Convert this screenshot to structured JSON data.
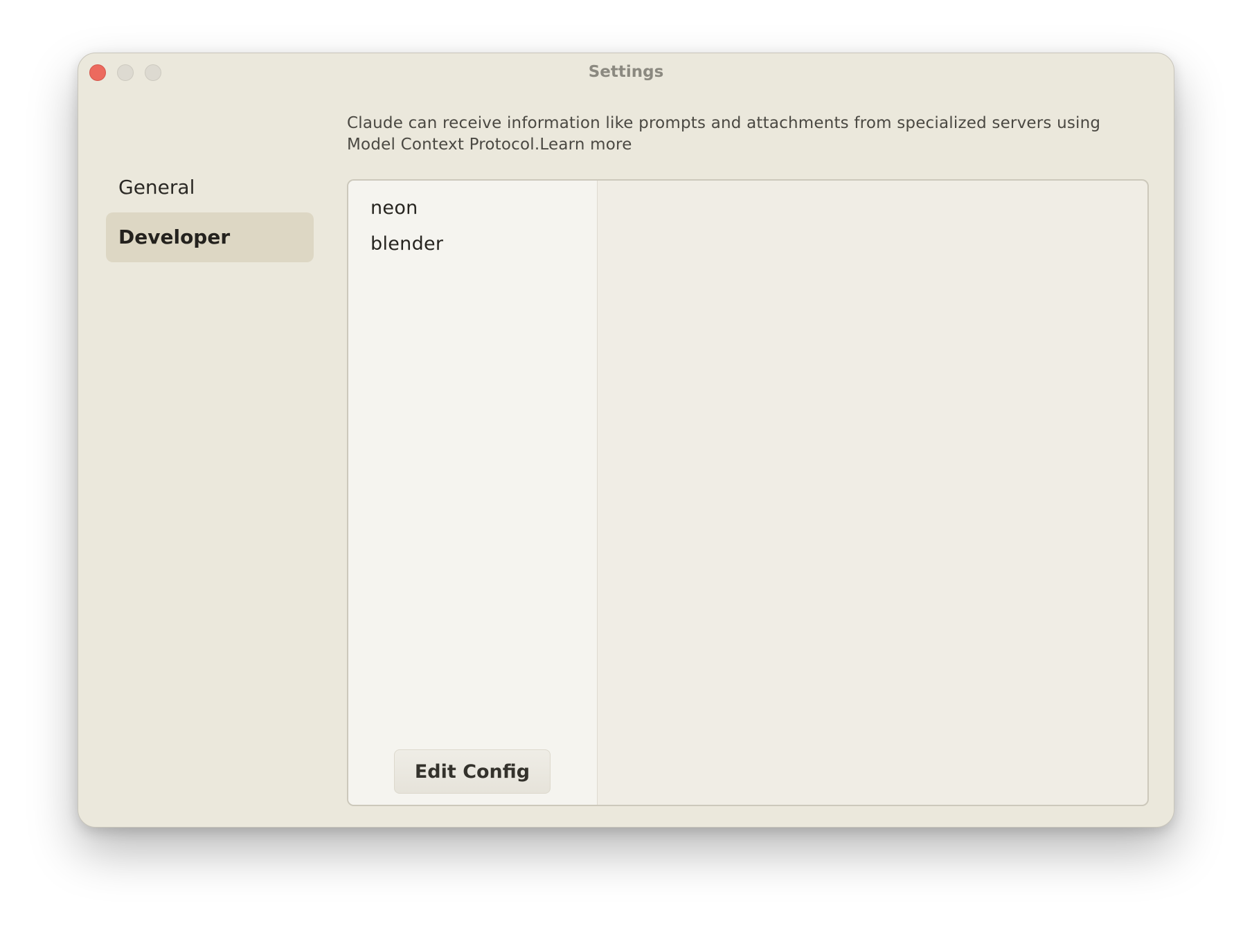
{
  "window": {
    "title": "Settings"
  },
  "sidebar": {
    "items": [
      {
        "label": "General",
        "active": false
      },
      {
        "label": "Developer",
        "active": true
      }
    ]
  },
  "main": {
    "description": "Claude can receive information like prompts and attachments from specialized servers using Model Context Protocol.",
    "learn_more": "Learn more",
    "servers": [
      {
        "name": "neon"
      },
      {
        "name": "blender"
      }
    ],
    "edit_config_label": "Edit Config"
  },
  "colors": {
    "window_bg": "#ebe8dc",
    "sidebar_active_bg": "#ddd7c4",
    "close_button": "#ec6a5e",
    "list_bg": "#f5f4ef",
    "detail_bg": "#f0ede5"
  }
}
